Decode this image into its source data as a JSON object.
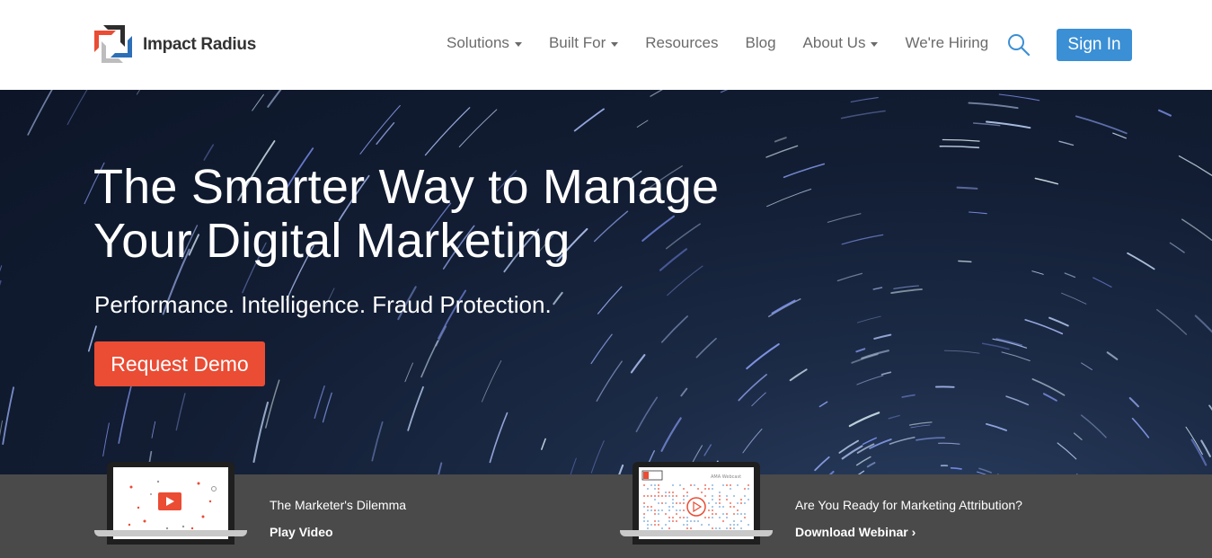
{
  "header": {
    "logo_text": "Impact Radius",
    "nav": [
      {
        "label": "Solutions",
        "dropdown": true
      },
      {
        "label": "Built For",
        "dropdown": true
      },
      {
        "label": "Resources",
        "dropdown": false
      },
      {
        "label": "Blog",
        "dropdown": false
      },
      {
        "label": "About Us",
        "dropdown": true
      },
      {
        "label": "We're Hiring",
        "dropdown": false
      }
    ],
    "search_icon": "search-icon",
    "signin_label": "Sign In"
  },
  "hero": {
    "title_line1": "The Smarter Way to Manage",
    "title_line2": "Your Digital Marketing",
    "subtitle": "Performance. Intelligence. Fraud Protection.",
    "cta_label": "Request Demo"
  },
  "promos": [
    {
      "title": "The Marketer's Dilemma",
      "link": "Play Video"
    },
    {
      "title": "Are You Ready for Marketing Attribution?",
      "link": "Download Webinar ›",
      "webinar_tag": "AMA Webcast"
    }
  ],
  "colors": {
    "accent_orange": "#ea4c34",
    "accent_blue": "#3b8fd4",
    "strip_bg": "#4a4a4a"
  }
}
